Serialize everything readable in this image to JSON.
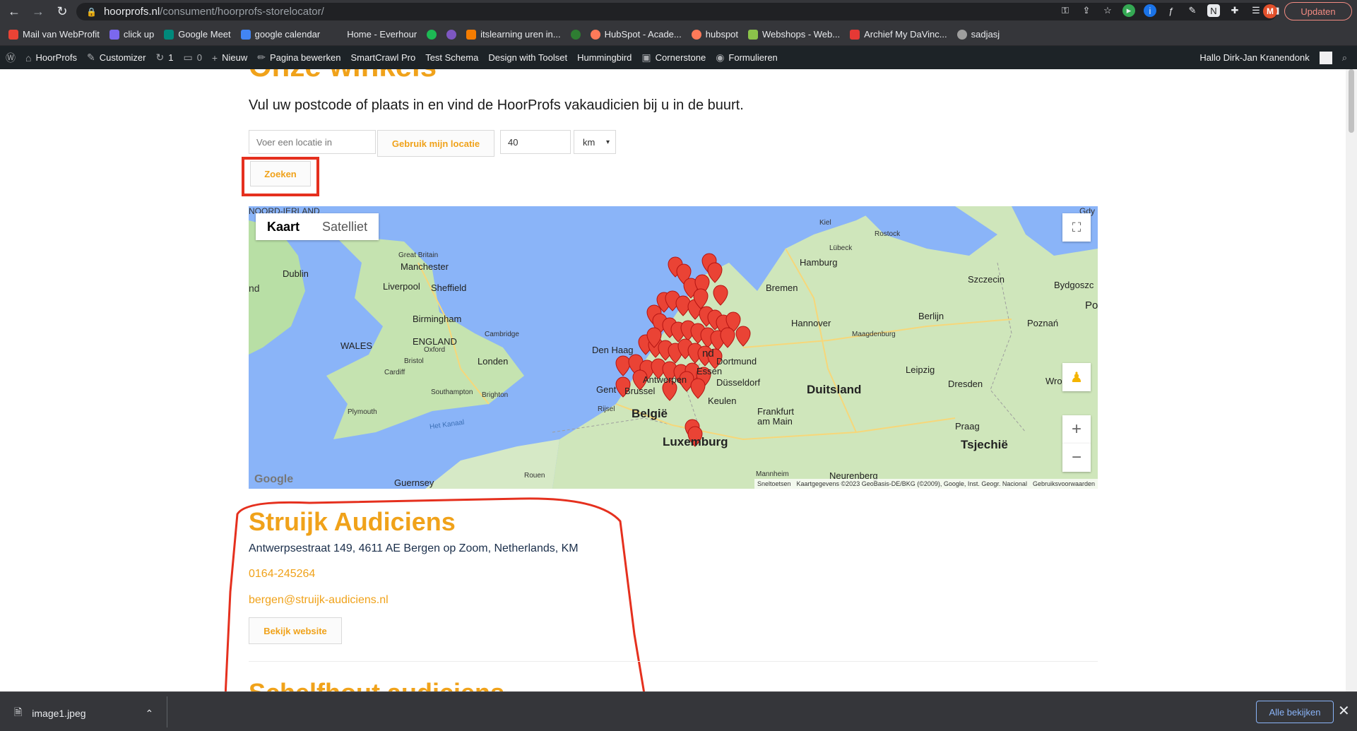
{
  "browser": {
    "url_domain": "hoorprofs.nl",
    "url_path": "/consument/hoorprofs-storelocator/",
    "avatar_letter": "M",
    "update_label": "Updaten"
  },
  "bookmarks": [
    {
      "label": "Mail van WebProfit",
      "color": "#ea4335"
    },
    {
      "label": "click up",
      "color": "#7b68ee"
    },
    {
      "label": "Google Meet",
      "color": "#00897b"
    },
    {
      "label": "google calendar",
      "color": "#4285f4"
    },
    {
      "label": "Home - Everhour",
      "color": ""
    },
    {
      "label": "",
      "color": "#1db954"
    },
    {
      "label": "",
      "color": "#7e57c2"
    },
    {
      "label": "itslearning uren in...",
      "color": "#f57c00"
    },
    {
      "label": "",
      "color": "#2e7d32"
    },
    {
      "label": "HubSpot - Acade...",
      "color": "#ff7a59"
    },
    {
      "label": "hubspot",
      "color": "#ff7a59"
    },
    {
      "label": "Webshops - Web...",
      "color": "#8bc34a"
    },
    {
      "label": "Archief My DaVinc...",
      "color": "#e53935"
    },
    {
      "label": "sadjasj",
      "color": "#9e9e9e"
    }
  ],
  "wpbar": {
    "site": "HoorProfs",
    "customizer": "Customizer",
    "updates": "1",
    "comments": "0",
    "new": "Nieuw",
    "edit": "Pagina bewerken",
    "smartcrawl": "SmartCrawl Pro",
    "test_schema": "Test Schema",
    "toolset": "Design with Toolset",
    "hummingbird": "Hummingbird",
    "cornerstone": "Cornerstone",
    "forms": "Formulieren",
    "greeting": "Hallo Dirk-Jan Kranendonk"
  },
  "page": {
    "heading": "Onze winkels",
    "intro": "Vul uw postcode of plaats in en vind de HoorProfs vakaudicien bij u in de buurt.",
    "location_placeholder": "Voer een locatie in",
    "use_location_label": "Gebruik mijn locatie",
    "radius_value": "40",
    "unit_value": "km",
    "search_label": "Zoeken"
  },
  "map": {
    "tab_map": "Kaart",
    "tab_satellite": "Satelliet",
    "labels": {
      "noord_ierland": "NOORD-IERLAND",
      "great_britain": "Great Britain",
      "dublin": "Dublin",
      "manchester": "Manchester",
      "liverpool": "Liverpool",
      "sheffield": "Sheffield",
      "birmingham": "Birmingham",
      "cambridge": "Cambridge",
      "wales": "WALES",
      "england": "ENGLAND",
      "oxford": "Oxford",
      "london": "Londen",
      "bristol": "Bristol",
      "cardiff": "Cardiff",
      "southampton": "Southampton",
      "brighton": "Brighton",
      "plymouth": "Plymouth",
      "het_kanaal": "Het Kanaal",
      "guernsey": "Guernsey",
      "rouen": "Rouen",
      "den_haag": "Den Haag",
      "gent": "Gent",
      "brussel": "Brussel",
      "antwerpen": "Antwerpen",
      "belgie": "België",
      "rijsel": "Rijsel",
      "luxemburg": "Luxemburg",
      "essen": "Essen",
      "dusseldorf": "Düsseldorf",
      "keulen": "Keulen",
      "dortmund": "Dortmund",
      "frankfurt": "Frankfurt am Main",
      "mannheim": "Mannheim",
      "neurenberg": "Neurenberg",
      "bremen": "Bremen",
      "hamburg": "Hamburg",
      "kiel": "Kiel",
      "lubeck": "Lübeck",
      "rostock": "Rostock",
      "hannover": "Hannover",
      "maagdenburg": "Maagdenburg",
      "berlijn": "Berlijn",
      "duitsland": "Duitsland",
      "leipzig": "Leipzig",
      "dresden": "Dresden",
      "szczecin": "Szczecin",
      "poznan": "Poznań",
      "bydgoszcz": "Bydgoszc",
      "wroclaw": "Wrocław",
      "praag": "Praag",
      "tsjechie": "Tsjechië",
      "po": "Po",
      "gdy": "Gdy",
      "nd": "nd"
    },
    "google": "Google",
    "shortcuts": "Sneltoetsen",
    "map_data": "Kaartgegevens ©2023 GeoBasis-DE/BKG (©2009), Google, Inst. Geogr. Nacional",
    "terms": "Gebruiksvoorwaarden"
  },
  "store": {
    "name": "Struijk Audiciens",
    "address": "Antwerpsestraat 149, 4611 AE Bergen op Zoom, Netherlands, KM",
    "phone": "0164-245264",
    "email": "bergen@struijk-audiciens.nl",
    "website_label": "Bekijk website"
  },
  "next_store": {
    "name": "Schelfhout audiciens"
  },
  "downloads": {
    "file": "image1.jpeg",
    "show_all": "Alle bekijken"
  }
}
